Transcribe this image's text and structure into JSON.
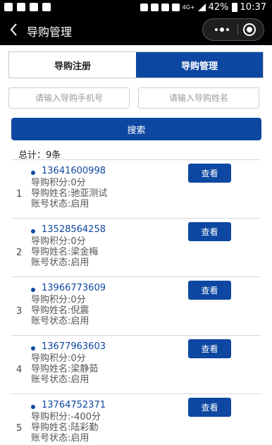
{
  "status_bar": {
    "network": "4G+",
    "battery": "42%",
    "time": "10:37"
  },
  "nav": {
    "title": "导购管理",
    "icons": [
      "back-icon",
      "more-icon",
      "close-icon"
    ]
  },
  "tabs": [
    {
      "label": "导购注册",
      "active": false
    },
    {
      "label": "导购管理",
      "active": true
    }
  ],
  "search": {
    "phone_placeholder": "请输入导购手机号",
    "name_placeholder": "请输入导购姓名",
    "button_label": "搜索"
  },
  "total_label": "总计：9条",
  "colors": {
    "accent": "#0d47a1",
    "bar": "#000000"
  },
  "guides": [
    {
      "index": "1",
      "phone": "13641600998",
      "points": "导购积分:0分",
      "name": "导购姓名:驰亚测试",
      "status": "账号状态:启用",
      "button": "查看"
    },
    {
      "index": "2",
      "phone": "13528564258",
      "points": "导购积分:0分",
      "name": "导购姓名:梁金梅",
      "status": "账号状态:启用",
      "button": "查看"
    },
    {
      "index": "3",
      "phone": "13966773609",
      "points": "导购积分:0分",
      "name": "导购姓名:倪震",
      "status": "账号状态:启用",
      "button": "查看"
    },
    {
      "index": "4",
      "phone": "13677963603",
      "points": "导购积分:0分",
      "name": "导购姓名:梁静茹",
      "status": "账号状态:启用",
      "button": "查看"
    },
    {
      "index": "5",
      "phone": "13764752371",
      "points": "导购积分:-400分",
      "name": "导购姓名:陆彩勤",
      "status": "账号状态:启用",
      "button": "查看"
    }
  ]
}
